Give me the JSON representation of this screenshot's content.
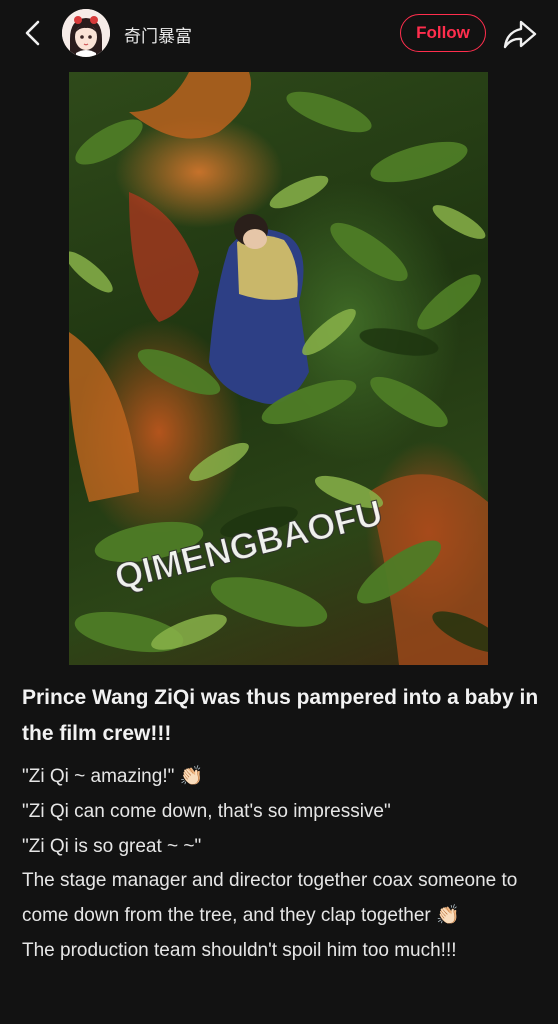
{
  "header": {
    "back_icon": "chevron-left-icon",
    "author_name": "奇门暴富",
    "follow_label": "Follow",
    "follow_color": "#ff2e4d",
    "share_icon": "share-arrow-icon"
  },
  "post": {
    "image_watermark": "QIMENGBAOFU",
    "title": "Prince Wang ZiQi was thus pampered into a baby in the film crew!!!",
    "lines": [
      "\"Zi Qi ~ amazing!\" 👏🏻",
      "\"Zi Qi can come down, that's so impressive\"",
      "\"Zi Qi is so great ~ ~\"",
      "The stage manager and director together coax someone to come down from the tree, and they clap together 👏🏻",
      "The production team shouldn't spoil him too much!!!"
    ]
  },
  "colors": {
    "background": "#121212",
    "text": "#e9e9e9",
    "accent": "#ff2e4d"
  }
}
